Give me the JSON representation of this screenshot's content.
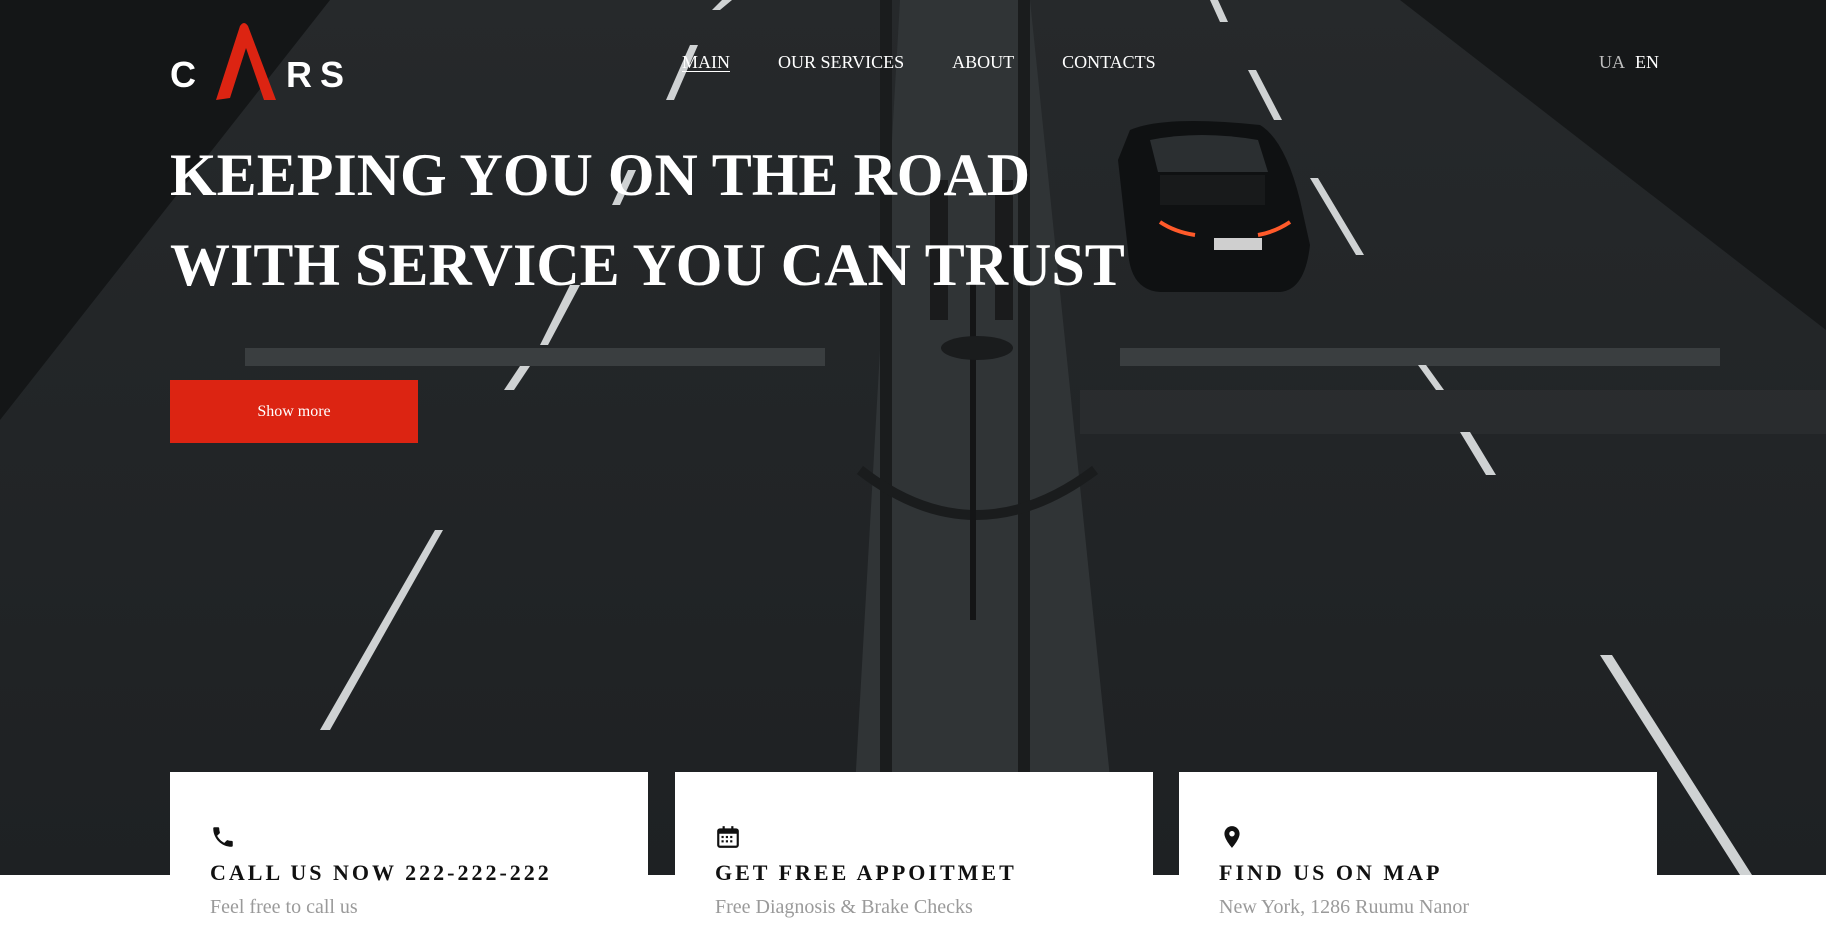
{
  "brand": {
    "logo_text_left": "C",
    "logo_text_right_1": "R",
    "logo_text_right_2": "S",
    "accent": "#dc2412"
  },
  "nav": {
    "items": [
      {
        "label": "MAIN",
        "active": true
      },
      {
        "label": "OUR SERVICES"
      },
      {
        "label": "ABOUT"
      },
      {
        "label": "CONTACTS"
      }
    ]
  },
  "lang": {
    "ua": "UA",
    "en": "EN"
  },
  "hero": {
    "line1": "KEEPING YOU ON THE ROAD",
    "line2": "WITH SERVICE YOU CAN TRUST",
    "button": "Show more"
  },
  "cards": [
    {
      "icon": "phone-icon",
      "title": "CALL US NOW 222-222-222",
      "sub": "Feel free to call us"
    },
    {
      "icon": "calendar-icon",
      "title": "GET FREE APPOITMET",
      "sub": "Free Diagnosis & Brake Checks"
    },
    {
      "icon": "map-pin-icon",
      "title": "FIND US ON MAP",
      "sub": "New York, 1286 Ruumu Nanor"
    }
  ]
}
